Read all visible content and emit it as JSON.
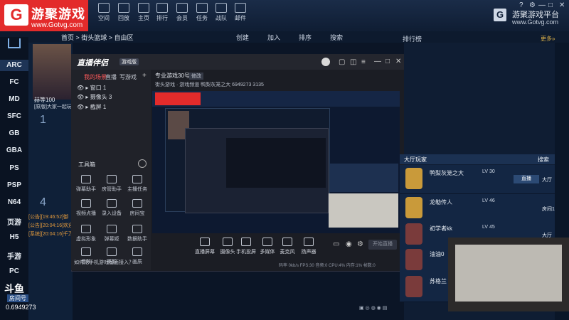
{
  "brand": {
    "name": "游聚游戏",
    "url": "www.Gotvg.com",
    "right_name": "游聚游戏平台",
    "right_url": "www.Gotvg.com"
  },
  "topnav": [
    {
      "label": "空间"
    },
    {
      "label": "回放"
    },
    {
      "label": "主页"
    },
    {
      "label": "排行"
    },
    {
      "label": "会员"
    },
    {
      "label": "任务"
    },
    {
      "label": "战队"
    },
    {
      "label": "邮件"
    }
  ],
  "window_controls": {
    "help": "?",
    "settings": "⚙",
    "minimize": "—",
    "maximize": "□",
    "close": "✕"
  },
  "breadcrumb": "首页 > 街头篮球 > 自由区",
  "sub_actions": [
    "创建",
    "加入",
    "排序",
    "搜索"
  ],
  "ranking": {
    "title": "排行榜",
    "more": "更多»"
  },
  "sidebar": [
    "ARC",
    "FC",
    "MD",
    "SFC",
    "GB",
    "GBA",
    "PS",
    "PSP",
    "N64",
    "页游",
    "H5",
    "手游",
    "PC"
  ],
  "left_panel": {
    "streamer_name": "赫等100",
    "caption": "[原版]大家一起玩",
    "room_nums": [
      "1",
      "4"
    ]
  },
  "logs": [
    "[公告][19:46:52]御",
    "[公告][20:04:16]欢迎",
    "[系统][20:04:16]千万"
  ],
  "douyu": {
    "logo": "斗鱼",
    "label": "房间号",
    "room_id": "0.6949273"
  },
  "studio": {
    "logo": "直播伴侣",
    "subtitle": "游戏版",
    "tabs": [
      "我的场景",
      "直播",
      "写游戏"
    ],
    "scenes": [
      "窗口 1",
      "摄像头 3",
      "截屏 1"
    ],
    "toolbox_label": "工具箱",
    "tools": [
      "弹幕助手",
      "房管助手",
      "主播任务",
      "视频点播",
      "录入设备",
      "房间宝",
      "虚拟形象",
      "弹幕姬",
      "数据助手",
      "音效",
      "美颜",
      "画质"
    ],
    "info1": "专业游戏30号1",
    "edit": "修改",
    "info2": "街头游戏 · 游戏频道   鸭梨灰笼之大   6949273   3135",
    "bottom_tools": [
      "直播屏幕",
      "摄像头",
      "手机投屏",
      "多媒体",
      "麦克风",
      "扬声器"
    ],
    "start_live": "开始直播",
    "tip": "如何把手机游戏画面接入？",
    "status": "码率 0kb/s  FPS:30  音频:0  CPU:4%  内存:1%  帧数:0"
  },
  "hall": {
    "title": "大厅玩家",
    "search": "搜索"
  },
  "players": [
    {
      "name": "鸭梨灰笼之大",
      "level": "LV 30",
      "status": "大厅",
      "badge": "直播"
    },
    {
      "name": "龙勒传人",
      "level": "LV 46",
      "status": "房间1"
    },
    {
      "name": "初学者kk",
      "level": "LV 45",
      "status": "大厅"
    },
    {
      "name": "油油0",
      "level": "",
      "status": ""
    },
    {
      "name": "苏格兰",
      "level": "",
      "status": ""
    }
  ]
}
